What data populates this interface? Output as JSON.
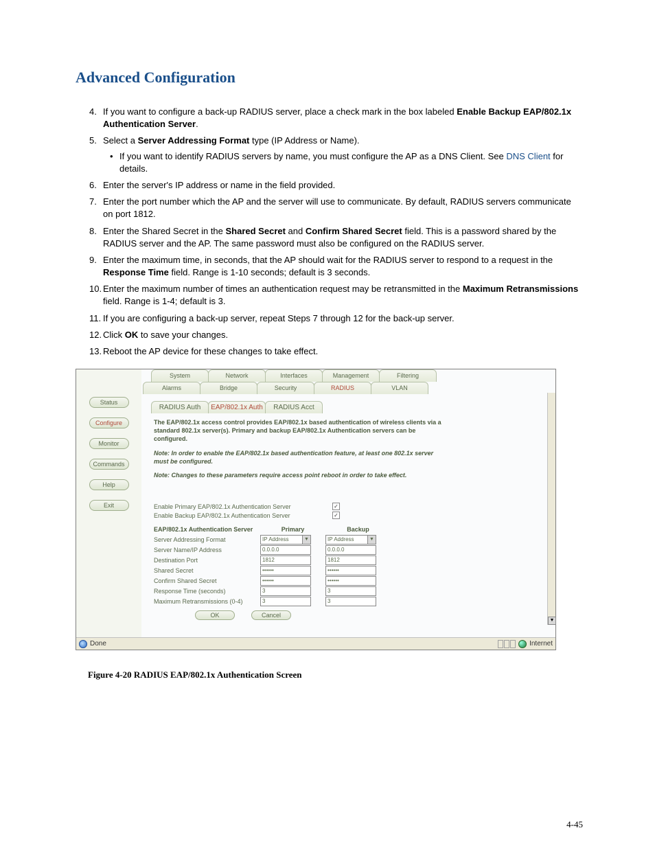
{
  "section_title": "Advanced Configuration",
  "steps": {
    "s4_a": "If you want to configure a back-up RADIUS server, place a check mark in the box labeled ",
    "s4_b": "Enable Backup EAP/802.1x Authentication Server",
    "s4_c": ".",
    "s5_a": "Select a ",
    "s5_b": "Server Addressing Format",
    "s5_c": " type (IP Address or Name).",
    "s5_bullet_a": "If you want to identify RADIUS servers by name, you must configure the AP as a DNS Client. See ",
    "s5_bullet_link": "DNS Client",
    "s5_bullet_b": " for details.",
    "s6": "Enter the server's IP address or name in the field provided.",
    "s7": "Enter the port number which the AP and the server will use to communicate. By default, RADIUS servers communicate on port 1812.",
    "s8_a": "Enter the Shared Secret in the ",
    "s8_b": "Shared Secret",
    "s8_c": " and ",
    "s8_d": "Confirm Shared Secret",
    "s8_e": " field. This is a password shared by the RADIUS server and the AP. The same password must also be configured on the RADIUS server.",
    "s9_a": "Enter the maximum time, in seconds, that the AP should wait for the RADIUS server to respond to a request in the ",
    "s9_b": "Response Time",
    "s9_c": " field. Range is 1-10 seconds; default is 3 seconds.",
    "s10_a": "Enter the maximum number of times an authentication request may be retransmitted in the ",
    "s10_b": "Maximum Retransmissions",
    "s10_c": " field. Range is 1-4; default is 3.",
    "s11": "If you are configuring a back-up server, repeat Steps 7 through 12 for the back-up server.",
    "s12_a": "Click ",
    "s12_b": "OK",
    "s12_c": " to save your changes.",
    "s13": "Reboot the AP device for these changes to take effect."
  },
  "nums": {
    "n4": "4.",
    "n5": "5.",
    "n6": "6.",
    "n7": "7.",
    "n8": "8.",
    "n9": "9.",
    "n10": "10.",
    "n11": "11.",
    "n12": "12.",
    "n13": "13."
  },
  "shot": {
    "tabs1": {
      "system": "System",
      "network": "Network",
      "interfaces": "Interfaces",
      "management": "Management",
      "filtering": "Filtering"
    },
    "tabs2": {
      "alarms": "Alarms",
      "bridge": "Bridge",
      "security": "Security",
      "radius": "RADIUS",
      "vlan": "VLAN"
    },
    "sidebar": {
      "status": "Status",
      "configure": "Configure",
      "monitor": "Monitor",
      "commands": "Commands",
      "help": "Help",
      "exit": "Exit"
    },
    "subtabs": {
      "auth": "RADIUS Auth",
      "eap": "EAP/802.1x Auth",
      "acct": "RADIUS Acct"
    },
    "desc": "The EAP/802.1x access control provides EAP/802.1x based authentication of wireless clients via a standard 802.1x server(s). Primary and backup EAP/802.1x Authentication servers can be configured.",
    "note1": "Note: In order to enable the EAP/802.1x based authentication feature, at least one 802.1x server must be configured.",
    "note2": "Note: Changes to these parameters require access point reboot in order to take effect.",
    "enable_primary": "Enable Primary EAP/802.1x Authentication Server",
    "enable_backup": "Enable Backup EAP/802.1x Authentication Server",
    "colhdr": {
      "server": "EAP/802.1x Authentication Server",
      "primary": "Primary",
      "backup": "Backup"
    },
    "rows": {
      "addr_fmt": "Server Addressing Format",
      "name_ip": "Server Name/IP Address",
      "port": "Destination Port",
      "secret": "Shared Secret",
      "confirm": "Confirm Shared Secret",
      "resp": "Response Time (seconds)",
      "retrans": "Maximum Retransmissions (0-4)"
    },
    "vals": {
      "addr_sel": "IP Address",
      "ip": "0.0.0.0",
      "port": "1812",
      "secret": "••••••",
      "resp": "3",
      "retrans": "3"
    },
    "buttons": {
      "ok": "OK",
      "cancel": "Cancel"
    },
    "status": {
      "done": "Done",
      "internet": "Internet"
    },
    "check": "✓"
  },
  "figure_caption": "Figure 4-20   RADIUS EAP/802.1x Authentication Screen",
  "page_number": "4-45"
}
